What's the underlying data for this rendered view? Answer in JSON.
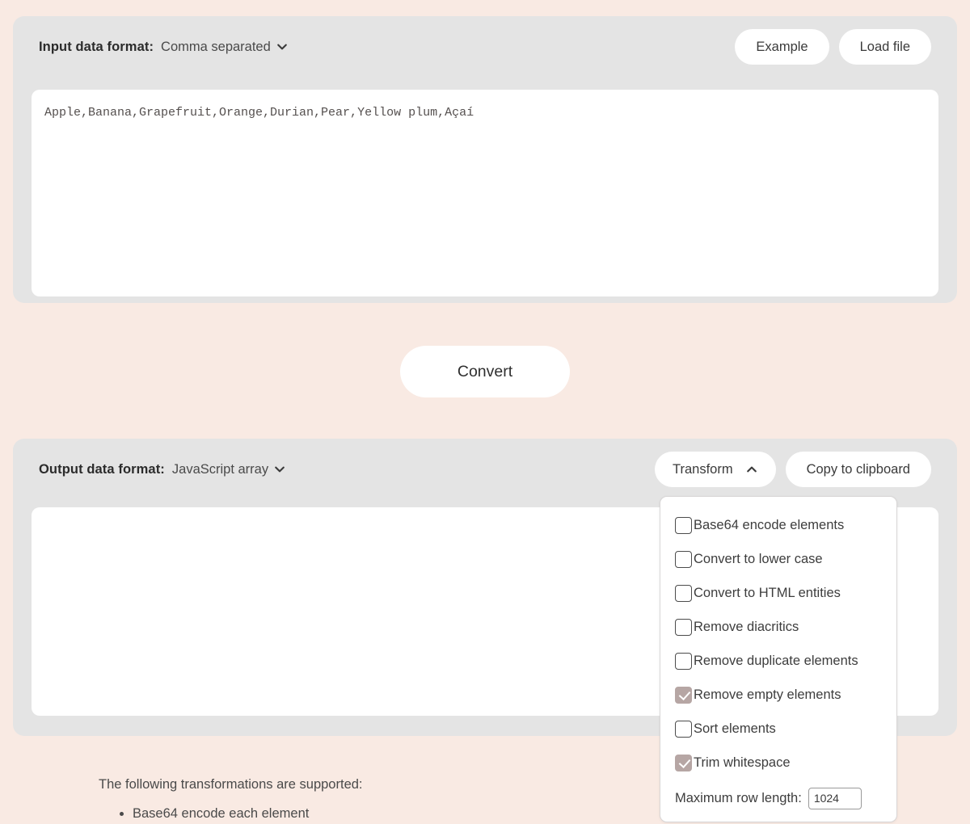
{
  "input_panel": {
    "format_label": "Input data format:",
    "format_value": "Comma separated",
    "format_caret_icon": "chevron-down-icon",
    "example_button": "Example",
    "load_file_button": "Load file",
    "textarea_value": "Apple,Banana,Grapefruit,Orange,Durian,Pear,Yellow plum,Açaí",
    "textarea_placeholder": ""
  },
  "convert": {
    "label": "Convert"
  },
  "output_panel": {
    "format_label": "Output data format:",
    "format_value": "JavaScript array",
    "format_caret_icon": "chevron-down-icon",
    "transform_button": "Transform",
    "transform_caret_icon": "chevron-up-icon",
    "copy_button": "Copy to clipboard",
    "textarea_value": "",
    "textarea_placeholder": ""
  },
  "transform_menu": {
    "open": true,
    "checked_color": "#b6a6a4",
    "items": [
      {
        "label": "Base64 encode elements",
        "checked": false
      },
      {
        "label": "Convert to lower case",
        "checked": false
      },
      {
        "label": "Convert to HTML entities",
        "checked": false
      },
      {
        "label": "Remove diacritics",
        "checked": false
      },
      {
        "label": "Remove duplicate elements",
        "checked": false
      },
      {
        "label": "Remove empty elements",
        "checked": true
      },
      {
        "label": "Sort elements",
        "checked": false
      },
      {
        "label": "Trim whitespace",
        "checked": true
      }
    ],
    "max_row_length_label": "Maximum row length:",
    "max_row_length_value": "1024"
  },
  "docs": {
    "intro": "The following transformations are supported:",
    "bullets": [
      "Base64 encode each element"
    ]
  },
  "theme": {
    "page_background": "#f9eae3",
    "panel_background": "#e4e4e4",
    "surface": "#ffffff",
    "accent": "#b6a6a4"
  }
}
